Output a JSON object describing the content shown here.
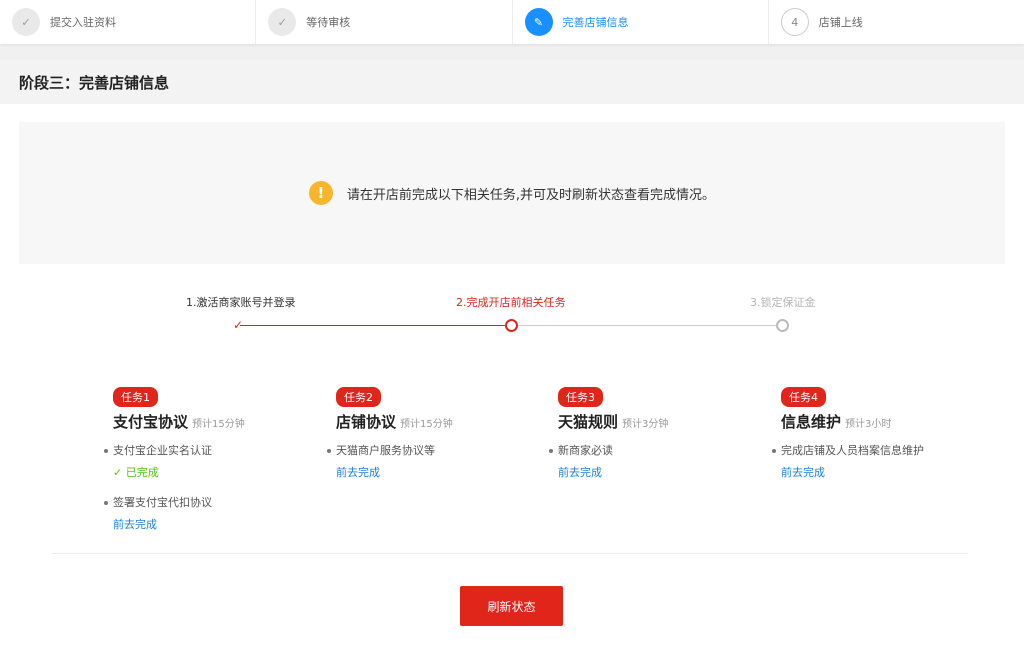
{
  "steps": [
    {
      "number": "✓",
      "label": "提交入驻资料"
    },
    {
      "number": "✓",
      "label": "等待审核"
    },
    {
      "number": "✎",
      "label": "完善店铺信息"
    },
    {
      "number": "4",
      "label": "店铺上线"
    }
  ],
  "section": {
    "title": "阶段三：完善店铺信息"
  },
  "notice": {
    "icon": "!",
    "text": "请在开店前完成以下相关任务,并可及时刷新状态查看完成情况。"
  },
  "progress": {
    "labels": [
      "1.激活商家账号并登录",
      "2.完成开店前相关任务",
      "3.锁定保证金"
    ],
    "check": "✓"
  },
  "tasks": [
    {
      "tag": "任务1",
      "title": "支付宝协议",
      "estimate": "预计15分钟",
      "items": [
        {
          "text": "支付宝企业实名认证",
          "status": "✓ 已完成"
        },
        {
          "text": "签署支付宝代扣协议",
          "link": "前去完成"
        }
      ]
    },
    {
      "tag": "任务2",
      "title": "店铺协议",
      "estimate": "预计15分钟",
      "items": [
        {
          "text": "天猫商户服务协议等",
          "link": "前去完成"
        }
      ]
    },
    {
      "tag": "任务3",
      "title": "天猫规则",
      "estimate": "预计3分钟",
      "items": [
        {
          "text": "新商家必读",
          "link": "前去完成"
        }
      ]
    },
    {
      "tag": "任务4",
      "title": "信息维护",
      "estimate": "预计3小时",
      "items": [
        {
          "text": "完成店铺及人员档案信息维护",
          "link": "前去完成"
        }
      ]
    }
  ],
  "refresh_label": "刷新状态",
  "colors": {
    "accent_red": "#e0251b",
    "active_blue": "#1890ff",
    "link_blue": "#1e7fd8",
    "success_green": "#52c41a",
    "warning_yellow": "#f7b52c"
  }
}
